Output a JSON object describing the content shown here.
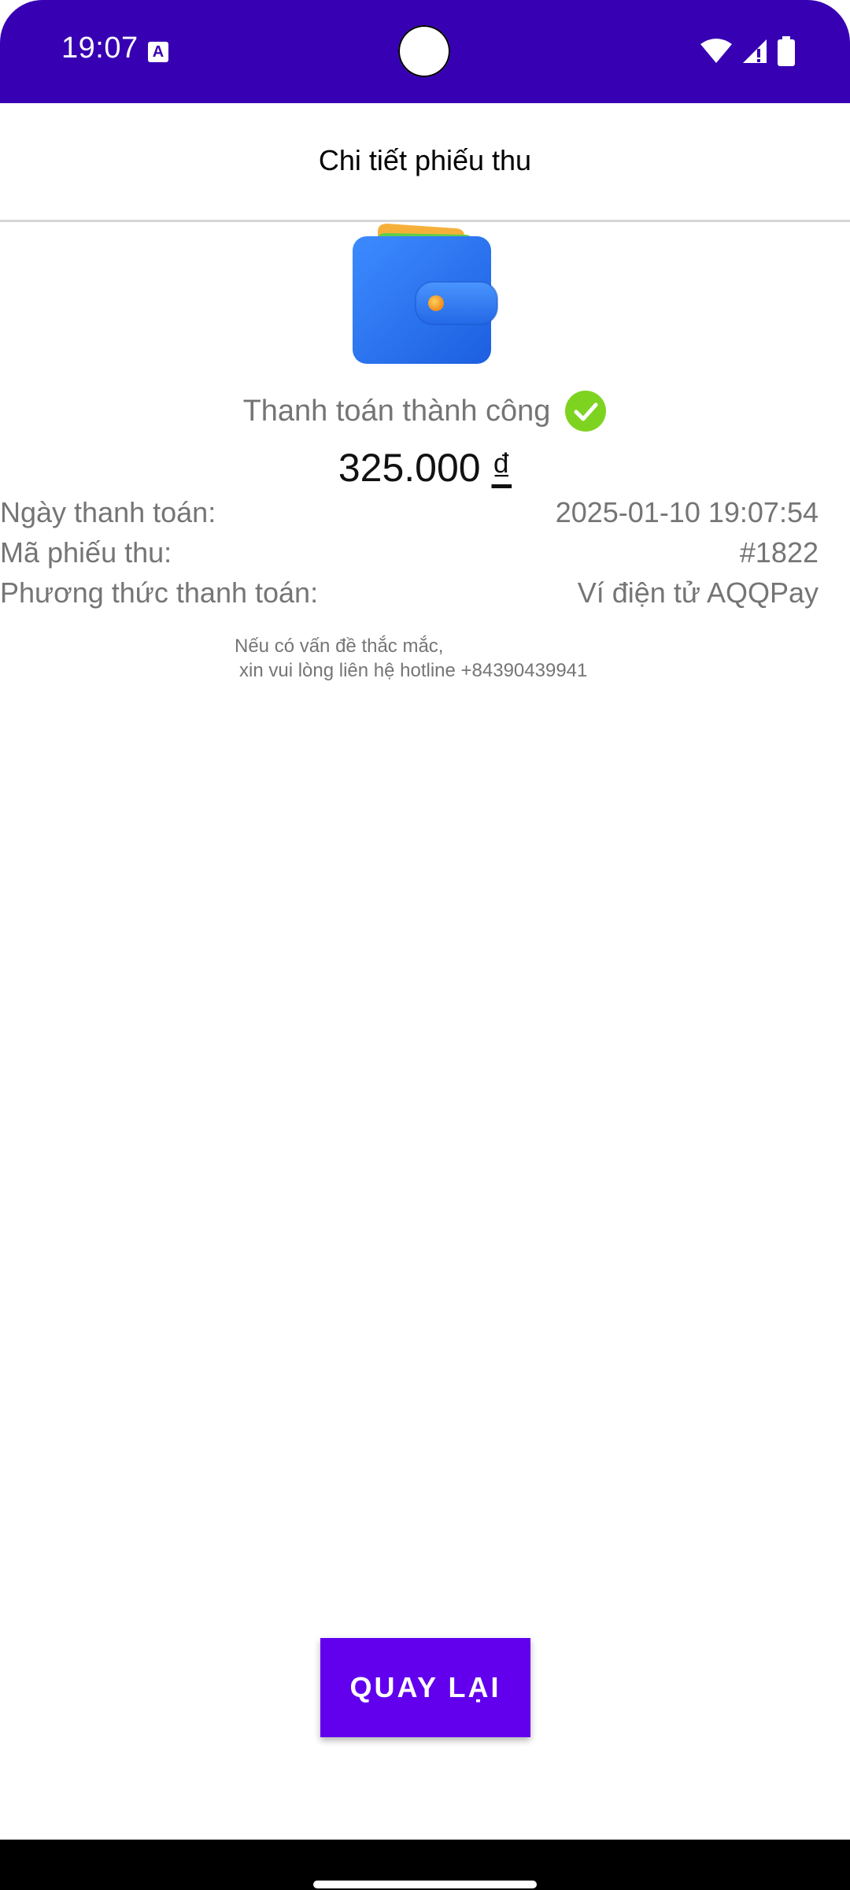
{
  "status_bar": {
    "time": "19:07",
    "notification_icon": "A",
    "icons": [
      "wifi-icon",
      "signal-icon",
      "battery-icon"
    ],
    "background": "#3700b3"
  },
  "toolbar": {
    "title": "Chi tiết phiếu thu"
  },
  "receipt": {
    "status_text": "Thanh toán thành công",
    "amount": "325.000",
    "currency": "₫",
    "rows": [
      {
        "label": "Ngày thanh toán:",
        "value": "2025-01-10 19:07:54"
      },
      {
        "label": "Mã phiếu thu:",
        "value": "#1822"
      },
      {
        "label": "Phương thức thanh toán:",
        "value": "Ví điện tử AQQPay"
      }
    ],
    "note_line1": "Nếu có vấn đề thắc mắc,",
    "note_line2": "xin vui lòng liên hệ hotline +84390439941"
  },
  "actions": {
    "back_label": "QUAY LẠI"
  },
  "colors": {
    "accent": "#6200ee",
    "success": "#7ed321",
    "muted_text": "#757575"
  }
}
